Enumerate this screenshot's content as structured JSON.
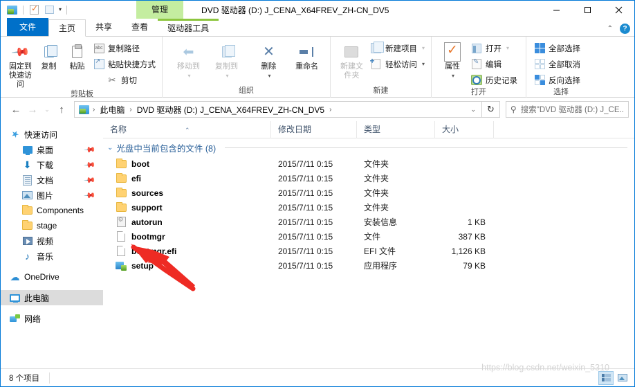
{
  "window": {
    "title": "DVD 驱动器 (D:) J_CENA_X64FREV_ZH-CN_DV5",
    "context_tab_banner": "管理",
    "minimize": "—",
    "maximize": "□",
    "close": "✕"
  },
  "quick_access_toolbar": {
    "caret": "▾"
  },
  "tabs": [
    {
      "label": "文件",
      "name": "tab-file"
    },
    {
      "label": "主页",
      "name": "tab-home"
    },
    {
      "label": "共享",
      "name": "tab-share"
    },
    {
      "label": "查看",
      "name": "tab-view"
    },
    {
      "label": "驱动器工具",
      "name": "tab-drive-tools"
    }
  ],
  "ribbon": {
    "collapse_chevron": "⌃",
    "help": "?",
    "groups": [
      {
        "label": "剪贴板",
        "big_buttons": [
          {
            "label": "固定到快速访问",
            "icon": "pin-icon"
          },
          {
            "label": "复制",
            "icon": "copy-icon"
          },
          {
            "label": "粘贴",
            "icon": "paste-icon"
          }
        ],
        "small_buttons": [
          {
            "label": "复制路径",
            "icon": "copy-path-icon"
          },
          {
            "label": "粘贴快捷方式",
            "icon": "paste-shortcut-icon"
          },
          {
            "label": "剪切",
            "icon": "scissors-icon"
          }
        ]
      },
      {
        "label": "组织",
        "big_buttons": [
          {
            "label": "移动到",
            "icon": "move-to-icon",
            "caret": "▾",
            "disabled": true
          },
          {
            "label": "复制到",
            "icon": "copy-to-icon",
            "caret": "▾",
            "disabled": true
          },
          {
            "label": "删除",
            "icon": "delete-icon",
            "caret": "▾"
          },
          {
            "label": "重命名",
            "icon": "rename-icon"
          }
        ]
      },
      {
        "label": "新建",
        "big_buttons": [
          {
            "label": "新建文件夹",
            "icon": "new-folder-icon",
            "disabled": true
          }
        ],
        "small_buttons": [
          {
            "label": "新建项目",
            "icon": "new-item-icon",
            "caret": "▾",
            "disabled": true
          },
          {
            "label": "轻松访问",
            "icon": "easy-access-icon",
            "caret": "▾"
          }
        ]
      },
      {
        "label": "打开",
        "big_buttons": [
          {
            "label": "属性",
            "icon": "properties-icon",
            "caret": "▾"
          }
        ],
        "small_buttons": [
          {
            "label": "打开",
            "icon": "open-icon",
            "caret": "▾",
            "disabled": true
          },
          {
            "label": "编辑",
            "icon": "edit-icon",
            "disabled": true
          },
          {
            "label": "历史记录",
            "icon": "history-icon"
          }
        ]
      },
      {
        "label": "选择",
        "small_buttons": [
          {
            "label": "全部选择",
            "icon": "select-all-icon"
          },
          {
            "label": "全部取消",
            "icon": "select-none-icon"
          },
          {
            "label": "反向选择",
            "icon": "invert-selection-icon"
          }
        ]
      }
    ]
  },
  "address_bar": {
    "back": "←",
    "forward": "→",
    "recent": "⌄",
    "up": "↑",
    "breadcrumbs": [
      "此电脑",
      "DVD 驱动器 (D:) J_CENA_X64FREV_ZH-CN_DV5"
    ],
    "separator": "›",
    "dropdown": "⌄",
    "refresh": "↻"
  },
  "search": {
    "placeholder": "搜索\"DVD 驱动器 (D:) J_CE...",
    "icon": "search-icon"
  },
  "sidebar": {
    "items": [
      {
        "label": "快速访问",
        "icon": "star-icon",
        "indent": false,
        "pinned": false,
        "selected": false
      },
      {
        "label": "桌面",
        "icon": "desktop-icon",
        "indent": true,
        "pinned": true,
        "selected": false
      },
      {
        "label": "下载",
        "icon": "download-icon",
        "indent": true,
        "pinned": true,
        "selected": false
      },
      {
        "label": "文档",
        "icon": "document-icon",
        "indent": true,
        "pinned": true,
        "selected": false
      },
      {
        "label": "图片",
        "icon": "pictures-icon",
        "indent": true,
        "pinned": true,
        "selected": false
      },
      {
        "label": "Components",
        "icon": "folder-icon",
        "indent": true,
        "pinned": false,
        "selected": false
      },
      {
        "label": "stage",
        "icon": "folder-icon",
        "indent": true,
        "pinned": false,
        "selected": false
      },
      {
        "label": "视频",
        "icon": "video-icon",
        "indent": true,
        "pinned": false,
        "selected": false
      },
      {
        "label": "音乐",
        "icon": "music-icon",
        "indent": true,
        "pinned": false,
        "selected": false
      },
      {
        "label": "OneDrive",
        "icon": "onedrive-icon",
        "indent": false,
        "pinned": false,
        "selected": false
      },
      {
        "label": "此电脑",
        "icon": "this-pc-icon",
        "indent": false,
        "pinned": false,
        "selected": true
      },
      {
        "label": "网络",
        "icon": "network-icon",
        "indent": false,
        "pinned": false,
        "selected": false
      }
    ],
    "pin_glyph": "📌"
  },
  "file_list": {
    "columns": [
      {
        "label": "名称",
        "sorted": true,
        "sort_glyph": "⌃"
      },
      {
        "label": "修改日期",
        "sorted": false
      },
      {
        "label": "类型",
        "sorted": false
      },
      {
        "label": "大小",
        "sorted": false
      }
    ],
    "group": {
      "chevron": "⌄",
      "title": "光盘中当前包含的文件 (8)"
    },
    "rows": [
      {
        "name": "boot",
        "date": "2015/7/11 0:15",
        "type": "文件夹",
        "size": "",
        "icon": "folder-icon"
      },
      {
        "name": "efi",
        "date": "2015/7/11 0:15",
        "type": "文件夹",
        "size": "",
        "icon": "folder-icon"
      },
      {
        "name": "sources",
        "date": "2015/7/11 0:15",
        "type": "文件夹",
        "size": "",
        "icon": "folder-icon"
      },
      {
        "name": "support",
        "date": "2015/7/11 0:15",
        "type": "文件夹",
        "size": "",
        "icon": "folder-icon"
      },
      {
        "name": "autorun",
        "date": "2015/7/11 0:15",
        "type": "安装信息",
        "size": "1 KB",
        "icon": "setup-information-icon"
      },
      {
        "name": "bootmgr",
        "date": "2015/7/11 0:15",
        "type": "文件",
        "size": "387 KB",
        "icon": "generic-file-icon"
      },
      {
        "name": "bootmgr.efi",
        "date": "2015/7/11 0:15",
        "type": "EFI 文件",
        "size": "1,126 KB",
        "icon": "generic-file-icon"
      },
      {
        "name": "setup",
        "date": "2015/7/11 0:15",
        "type": "应用程序",
        "size": "79 KB",
        "icon": "application-icon"
      }
    ]
  },
  "annotation": {
    "arrow_color": "#ee2b24",
    "target": "setup"
  },
  "status_bar": {
    "item_count": "8 个项目",
    "view_details": "详细信息",
    "view_large_icons": "大图标"
  },
  "watermark": {
    "text": "https://blog.csdn.net/weixin_5310"
  },
  "colors": {
    "window_border": "#0078d7",
    "tab_file": "#0070c9",
    "context_banner": "#c4eda0",
    "context_tab_accent": "#8dc63f",
    "selection": "#dcdcdc",
    "group_title": "#2a6099"
  }
}
